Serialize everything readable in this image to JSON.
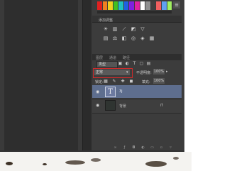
{
  "colors": {
    "screen": "#323232",
    "panel": "#3c3c3c",
    "selected_layer": "#5e6e8e",
    "highlight_box": "#d42a2a",
    "swatches": [
      "#e02020",
      "#f08020",
      "#f0d020",
      "#40c020",
      "#20c0c0",
      "#2060e0",
      "#8020e0",
      "#e020a0",
      "#ffffff",
      "#909090",
      "#404040",
      "#f06060",
      "#60a0f0",
      "#a0f060"
    ]
  },
  "adjustments": {
    "label": "添加调整",
    "row1_icons": [
      "brightness-icon",
      "levels-icon",
      "curves-icon",
      "exposure-icon",
      "vibrance-icon"
    ],
    "row2_icons": [
      "hsl-icon",
      "color-balance-icon",
      "bw-icon",
      "photo-filter-icon",
      "channel-mixer-icon",
      "color-lookup-icon"
    ]
  },
  "layers_panel": {
    "tabs": [
      "图层",
      "通道",
      "路径"
    ],
    "filter_kind": "类型",
    "blend_mode": "正常",
    "opacity_label": "不透明度:",
    "opacity_value": "100%",
    "lock_label": "锁定:",
    "fill_label": "填充:",
    "fill_value": "100%",
    "layers": [
      {
        "name": "3j",
        "type": "text",
        "thumb_glyph": "T",
        "selected": true
      },
      {
        "name": "背景",
        "type": "background",
        "locked": true,
        "selected": false
      }
    ]
  },
  "icons": {
    "swatch_menu": "≡",
    "eye": "◉",
    "lock": "🔒"
  }
}
